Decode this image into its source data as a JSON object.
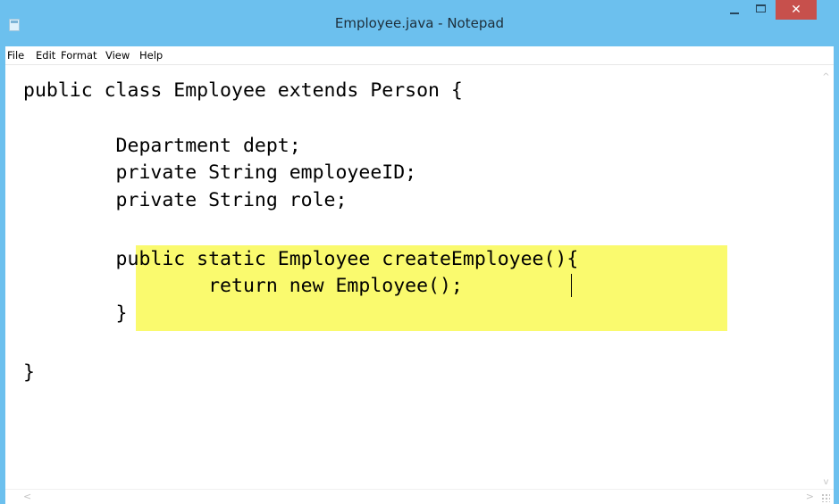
{
  "window": {
    "title": "Employee.java - Notepad",
    "close_glyph": "✕",
    "minimize_icon": "minimize-icon",
    "maximize_icon": "maximize-icon"
  },
  "menu": {
    "items": [
      "File",
      "Edit",
      "Format",
      "View",
      "Help"
    ]
  },
  "editor": {
    "lines": [
      "public class Employee extends Person {",
      "",
      "        Department dept;",
      "        private String employeeID;",
      "        private String role;",
      "",
      "        public static Employee createEmployee(){",
      "                return new Employee();",
      "        }",
      "",
      "}"
    ],
    "highlight_color": "#fafa6e"
  },
  "scrollbars": {
    "up_glyph": "^",
    "down_glyph": "v",
    "left_glyph": "<",
    "right_glyph": ">"
  },
  "colors": {
    "titlebar": "#6cc0ee",
    "close_button": "#c7504c"
  }
}
